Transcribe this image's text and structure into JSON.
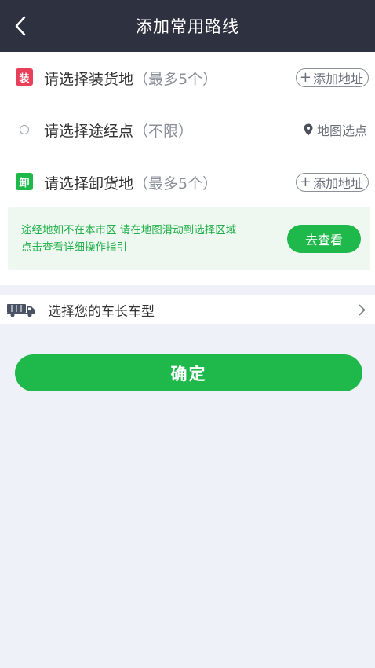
{
  "header": {
    "title": "添加常用路线",
    "back_icon": "chevron-left-icon"
  },
  "route": {
    "load": {
      "badge": "装",
      "label": "请选择装货地",
      "hint": "（最多5个）",
      "action_label": "添加地址",
      "action_plus": "+"
    },
    "via": {
      "label": "请选择途经点",
      "hint": "（不限）",
      "action_label": "地图选点",
      "action_icon": "map-pin-icon"
    },
    "unload": {
      "badge": "卸",
      "label": "请选择卸货地",
      "hint": "（最多5个）",
      "action_label": "添加地址",
      "action_plus": "+"
    }
  },
  "notice": {
    "line1": "途经地如不在本市区 请在地图滑动到选择区域",
    "line2": "点击查看详细操作指引",
    "button_label": "去查看"
  },
  "vehicle": {
    "label": "选择您的车长车型",
    "icon": "truck-icon",
    "chevron": "chevron-right-icon"
  },
  "confirm": {
    "label": "确定"
  },
  "colors": {
    "header_bg": "#2e3240",
    "accent_green": "#1fb84b",
    "load_badge": "#e8405a",
    "unload_badge": "#1fb84b",
    "page_bg": "#eef1f8",
    "notice_bg": "#eef8f0"
  }
}
